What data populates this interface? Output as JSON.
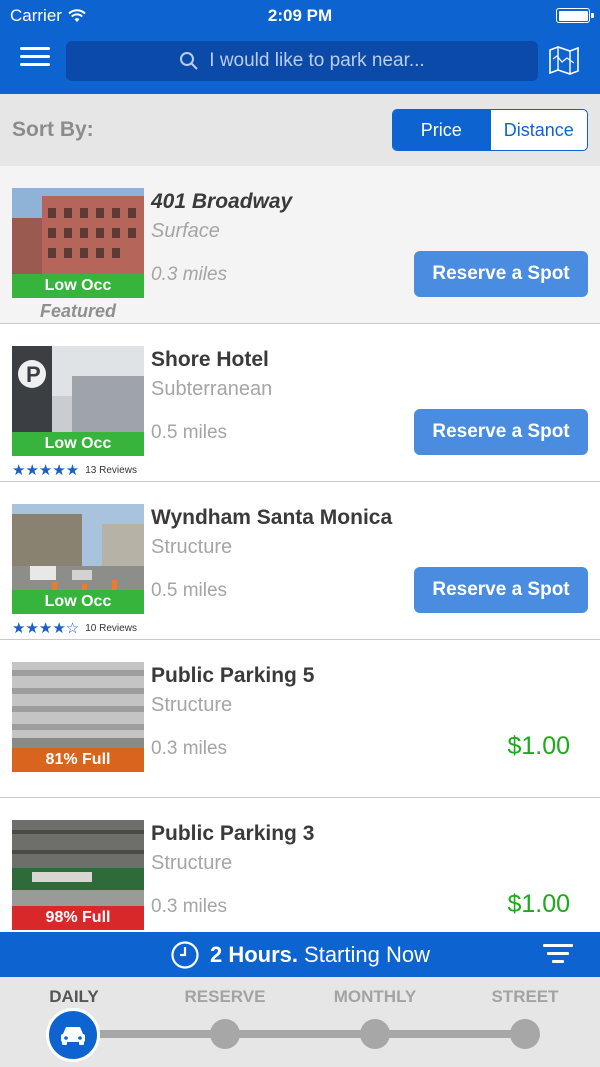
{
  "status_bar": {
    "carrier": "Carrier",
    "time": "2:09 PM"
  },
  "header": {
    "search_placeholder": "I would like to park near..."
  },
  "sort": {
    "label": "Sort By:",
    "options": [
      "Price",
      "Distance"
    ],
    "selected": "Price"
  },
  "listings": [
    {
      "name": "401 Broadway",
      "type": "Surface",
      "distance": "0.3 miles",
      "occupancy": "Low Occ",
      "featured_label": "Featured",
      "action": "Reserve a Spot"
    },
    {
      "name": "Shore Hotel",
      "type": "Subterranean",
      "distance": "0.5 miles",
      "occupancy": "Low Occ",
      "rating": 5,
      "reviews": "13 Reviews",
      "action": "Reserve a Spot"
    },
    {
      "name": "Wyndham Santa Monica",
      "type": "Structure",
      "distance": "0.5 miles",
      "occupancy": "Low Occ",
      "rating": 4,
      "reviews": "10 Reviews",
      "action": "Reserve a Spot"
    },
    {
      "name": "Public Parking 5",
      "type": "Structure",
      "distance": "0.3 miles",
      "occupancy": "81% Full",
      "price": "$1.00"
    },
    {
      "name": "Public Parking 3",
      "type": "Structure",
      "distance": "0.3 miles",
      "occupancy": "98% Full",
      "price": "$1.00"
    }
  ],
  "timebar": {
    "duration": "2 Hours.",
    "start": "Starting Now"
  },
  "tabs": [
    "DAILY",
    "RESERVE",
    "MONTHLY",
    "STREET"
  ],
  "active_tab": "DAILY",
  "colors": {
    "brand_blue": "#0d63cf",
    "button_blue": "#4a8de0",
    "price_green": "#1aab1a",
    "occ_green": "#37b43c",
    "occ_orange": "#d8641e",
    "occ_red": "#d9282a"
  }
}
